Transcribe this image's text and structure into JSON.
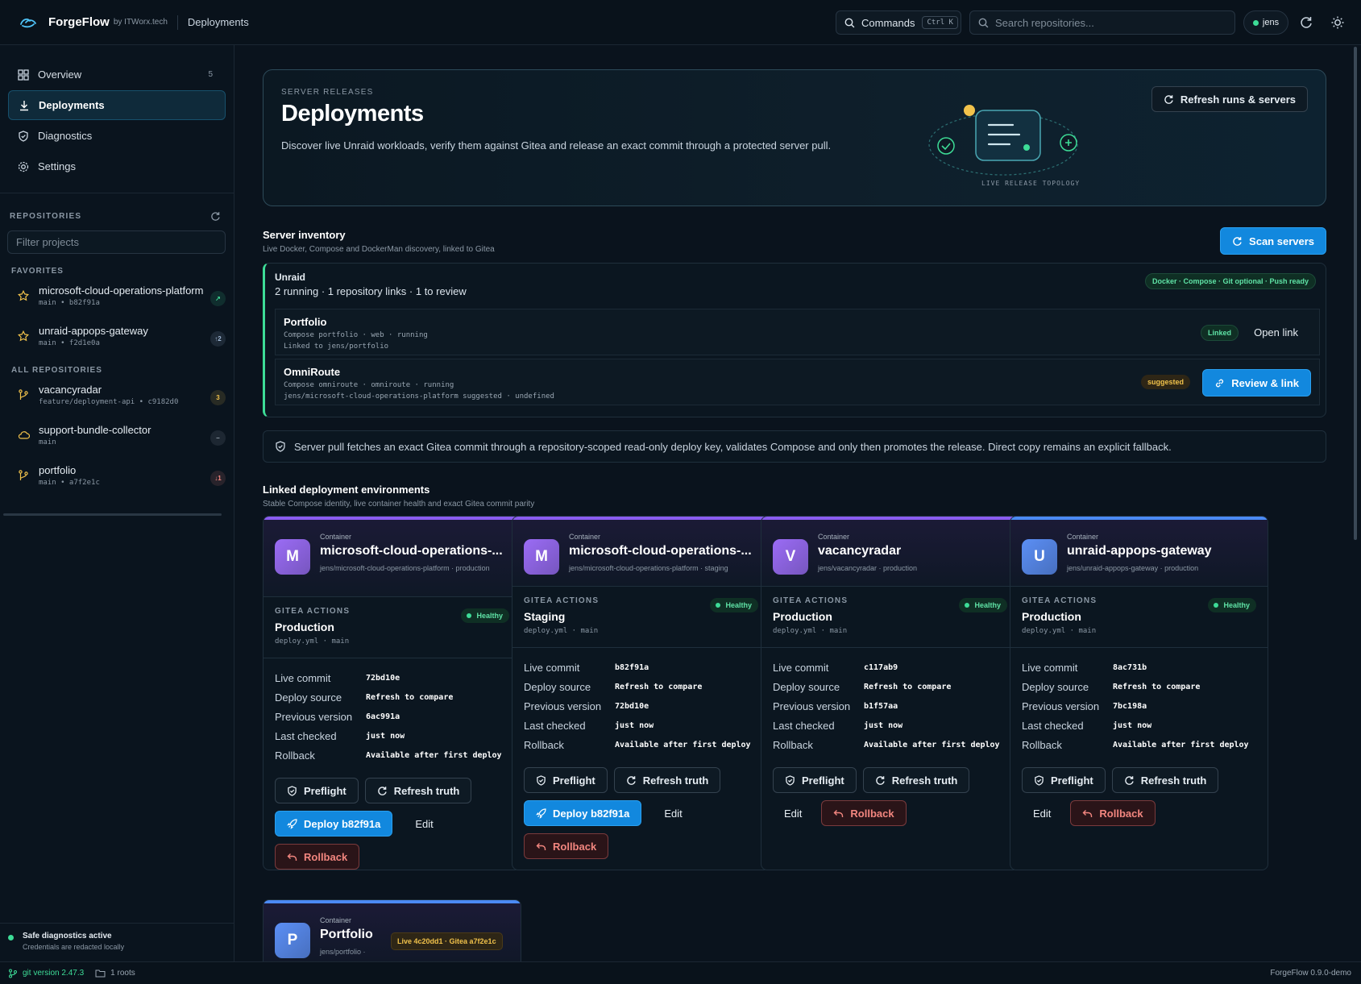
{
  "topbar": {
    "brand": "ForgeFlow",
    "by": "by ITWorx.tech",
    "crumb": "Deployments",
    "commands_label": "Commands",
    "commands_kbd": "Ctrl K",
    "search_placeholder": "Search repositories...",
    "user": "jens"
  },
  "sidebar": {
    "nav": [
      {
        "label": "Overview",
        "count": "5",
        "icon": "grid-icon"
      },
      {
        "label": "Deployments",
        "active": true,
        "icon": "download-icon"
      },
      {
        "label": "Diagnostics",
        "icon": "shield-check-icon"
      },
      {
        "label": "Settings",
        "icon": "gear-icon"
      }
    ],
    "repos_heading": "REPOSITORIES",
    "filter_placeholder": "Filter projects",
    "favorites_heading": "FAVORITES",
    "all_heading": "ALL REPOSITORIES",
    "favorites": [
      {
        "name": "microsoft-cloud-operations-platform",
        "branch": "main • b82f91a",
        "badge": "↗",
        "badge_color": "#3ddc97",
        "icon": "star-icon"
      },
      {
        "name": "unraid-appops-gateway",
        "branch": "main • f2d1e0a",
        "badge": "↑2",
        "badge_color": "#9fb7d4",
        "icon": "star-icon"
      }
    ],
    "all": [
      {
        "name": "vacancyradar",
        "branch": "feature/deployment-api • c9182d0",
        "badge": "3",
        "badge_color": "#f1c24b",
        "icon": "branch-icon"
      },
      {
        "name": "support-bundle-collector",
        "branch": "main",
        "badge": "–",
        "badge_color": "#9aa7b3",
        "icon": "cloud-icon"
      },
      {
        "name": "portfolio",
        "branch": "main • a7f2e1c",
        "badge": "↓1",
        "badge_color": "#f2867f",
        "icon": "branch-icon"
      }
    ],
    "safe_title": "Safe diagnostics active",
    "safe_sub": "Credentials are redacted locally"
  },
  "status": {
    "git": "git version 2.47.3",
    "roots": "1 roots",
    "version": "ForgeFlow 0.9.0-demo"
  },
  "hero": {
    "eyebrow": "SERVER RELEASES",
    "title": "Deployments",
    "description": "Discover live Unraid workloads, verify them against Gitea and release an exact commit through a protected server pull.",
    "refresh_button": "Refresh runs & servers",
    "topology_label": "LIVE RELEASE TOPOLOGY"
  },
  "inventory": {
    "title": "Server inventory",
    "subtitle": "Live Docker, Compose and DockerMan discovery, linked to Gitea",
    "scan_button": "Scan servers",
    "server_name": "Unraid",
    "server_summary": "2 running · 1 repository links · 1 to review",
    "capabilities": "Docker · Compose · Git optional · Push ready",
    "rows": [
      {
        "name": "Portfolio",
        "meta1": "Compose portfolio · web · running",
        "meta2": "Linked to jens/portfolio",
        "tag": "Linked",
        "action": "Open link"
      },
      {
        "name": "OmniRoute",
        "meta1": "Compose omniroute · omniroute · running",
        "meta2": "jens/microsoft-cloud-operations-platform suggested · undefined",
        "tag": "suggested",
        "action": "Review & link"
      }
    ]
  },
  "note": "Server pull fetches an exact Gitea commit through a repository-scoped read-only deploy key, validates Compose and only then promotes the release. Direct copy remains an explicit fallback.",
  "environments": {
    "title": "Linked deployment environments",
    "subtitle": "Stable Compose identity, live container health and exact Gitea commit parity",
    "labels": {
      "container": "Container",
      "gitea": "GITEA ACTIONS",
      "healthy": "Healthy",
      "live_commit": "Live commit",
      "deploy_source": "Deploy source",
      "previous_version": "Previous version",
      "last_checked": "Last checked",
      "rollback": "Rollback",
      "preflight": "Preflight",
      "refresh_truth": "Refresh truth",
      "edit": "Edit"
    },
    "cards": [
      {
        "initial": "M",
        "name": "microsoft-cloud-operations-...",
        "path": "jens/microsoft-cloud-operations-platform · production",
        "env": "Production",
        "file": "deploy.yml · main",
        "live_commit": "72bd10e",
        "deploy_source": "Refresh to compare",
        "previous_version": "6ac991a",
        "last_checked": "just now",
        "rollback": "Available after first deploy",
        "deploy_button": "Deploy b82f91a",
        "stripe": "#8a5cf0",
        "avatar": "#9b6cf5"
      },
      {
        "initial": "M",
        "name": "microsoft-cloud-operations-...",
        "path": "jens/microsoft-cloud-operations-platform · staging",
        "env": "Staging",
        "file": "deploy.yml · main",
        "live_commit": "b82f91a",
        "deploy_source": "Refresh to compare",
        "previous_version": "72bd10e",
        "last_checked": "just now",
        "rollback": "Available after first deploy",
        "deploy_button": "Deploy b82f91a",
        "stripe": "#8a5cf0",
        "avatar": "#9b6cf5"
      },
      {
        "initial": "V",
        "name": "vacancyradar",
        "path": "jens/vacancyradar · production",
        "env": "Production",
        "file": "deploy.yml · main",
        "live_commit": "c117ab9",
        "deploy_source": "Refresh to compare",
        "previous_version": "b1f57aa",
        "last_checked": "just now",
        "rollback": "Available after first deploy",
        "stripe": "#8a5cf0",
        "avatar": "#9b6cf5"
      },
      {
        "initial": "U",
        "name": "unraid-appops-gateway",
        "path": "jens/unraid-appops-gateway · production",
        "env": "Production",
        "file": "deploy.yml · main",
        "live_commit": "8ac731b",
        "deploy_source": "Refresh to compare",
        "previous_version": "7bc198a",
        "last_checked": "just now",
        "rollback": "Available after first deploy",
        "stripe": "#4b8af5",
        "avatar": "#5b8ff5"
      }
    ],
    "partial_card": {
      "initial": "P",
      "name": "Portfolio",
      "path": "jens/portfolio ·",
      "live_tag": "Live 4c20dd1 · Gitea a7f2e1c",
      "stripe": "#4b8af5",
      "avatar": "#5b8ff5"
    }
  }
}
